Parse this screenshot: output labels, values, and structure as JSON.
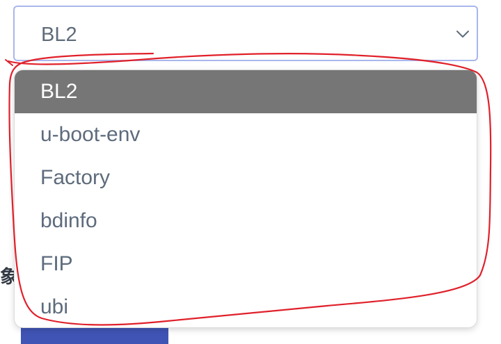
{
  "select": {
    "value": "BL2"
  },
  "dropdown": {
    "options": [
      "BL2",
      "u-boot-env",
      "Factory",
      "bdinfo",
      "FIP",
      "ubi"
    ],
    "selected": "BL2"
  },
  "background": {
    "partial_label": "象"
  },
  "icons": {
    "select_arrow": "chevron-down-icon"
  },
  "colors": {
    "select_border": "#a9b6ec",
    "selected_option_bg": "#767676",
    "option_text": "#5d6b7c",
    "annotation": "#e0202a",
    "background_button": "#3f54b5"
  }
}
